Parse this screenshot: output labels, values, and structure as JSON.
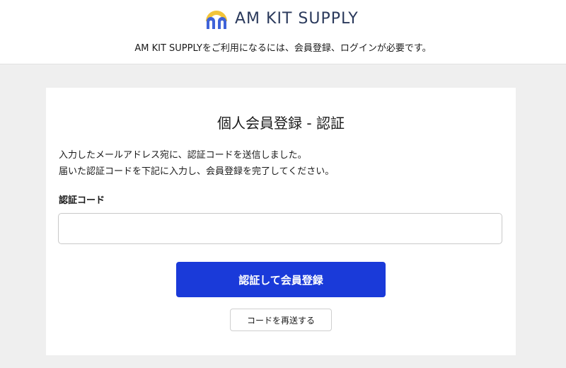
{
  "header": {
    "logo_text": "AM KIT SUPPLY",
    "logo_icon": "arch-logo-icon",
    "notice": "AM KIT SUPPLYをご利用になるには、会員登録、ログインが必要です。"
  },
  "card": {
    "title": "個人会員登録 - 認証",
    "description_line1": "入力したメールアドレス宛に、認証コードを送信しました。",
    "description_line2": "届いた認証コードを下記に入力し、会員登録を完了してください。",
    "code_label": "認証コード",
    "code_value": "",
    "submit_label": "認証して会員登録",
    "resend_label": "コードを再送する"
  },
  "colors": {
    "primary": "#1a3ad9",
    "logo_yellow": "#f2c43a",
    "logo_blue": "#3f63d9",
    "background": "#efefef"
  }
}
